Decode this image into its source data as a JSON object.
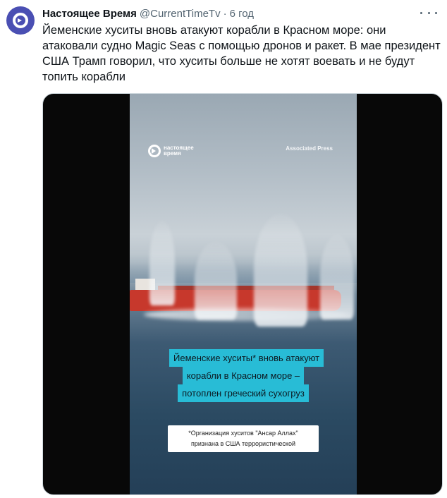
{
  "tweet": {
    "author_name": "Настоящее Время",
    "handle": "@CurrentTimeTv",
    "separator": "·",
    "time": "6 год",
    "text": "Йеменские хуситы вновь атакуют корабли в Красном море: они атаковали судно Magic Seas с помощью дронов и ракет. В мае президент США Трамп говорил, что хуситы больше не хотят воевать и не будут топить корабли"
  },
  "video": {
    "channel_logo_text": "настоящее время",
    "source_credit": "Associated Press",
    "headline_lines": [
      "Йеменские хуситы* вновь атакуют",
      "корабли в Красном море –",
      "потоплен греческий сухогруз"
    ],
    "footnote_lines": [
      "*Организация хуситов \"Ансар Аллах\"",
      "признана в США террористической"
    ]
  },
  "colors": {
    "avatar_bg": "#4a4fb3",
    "headline_bg": "#28bcd6",
    "ship_red": "#c7382c"
  },
  "icons": {
    "avatar": "current-time-logo",
    "more": "more-horizontal-icon"
  }
}
